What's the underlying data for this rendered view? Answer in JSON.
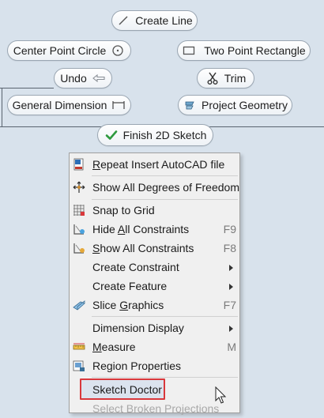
{
  "marking_menu": {
    "create_line": "Create Line",
    "center_point_circle": "Center Point Circle",
    "two_point_rectangle": "Two Point Rectangle",
    "undo": "Undo",
    "trim": "Trim",
    "general_dimension": "General Dimension",
    "project_geometry": "Project Geometry",
    "finish_2d_sketch": "Finish 2D Sketch"
  },
  "context_menu": {
    "repeat_insert": {
      "pre": "",
      "accel": "R",
      "post": "epeat Insert AutoCAD file"
    },
    "show_all_dof": {
      "label": "Show All Degrees of Freedom"
    },
    "snap_to_grid": {
      "label": "Snap to Grid"
    },
    "hide_all_constraints": {
      "pre": "Hide ",
      "accel": "A",
      "post": "ll Constraints",
      "shortcut": "F9"
    },
    "show_all_constraints": {
      "pre": "",
      "accel": "S",
      "post": "how All Constraints",
      "shortcut": "F8"
    },
    "create_constraint": {
      "label": "Create Constraint"
    },
    "create_feature": {
      "label": "Create Feature"
    },
    "slice_graphics": {
      "pre": "Slice ",
      "accel": "G",
      "post": "raphics",
      "shortcut": "F7"
    },
    "dimension_display": {
      "label": "Dimension Display"
    },
    "measure": {
      "pre": "",
      "accel": "M",
      "post": "easure",
      "shortcut": "M"
    },
    "region_properties": {
      "label": "Region Properties"
    },
    "sketch_doctor": {
      "label": "Sketch Doctor"
    },
    "select_broken_projections": {
      "label": "Select Broken Projections"
    }
  },
  "colors": {
    "background": "#d8e2ec",
    "highlight_border": "#d9383c",
    "checkmark": "#2e9a3e"
  }
}
